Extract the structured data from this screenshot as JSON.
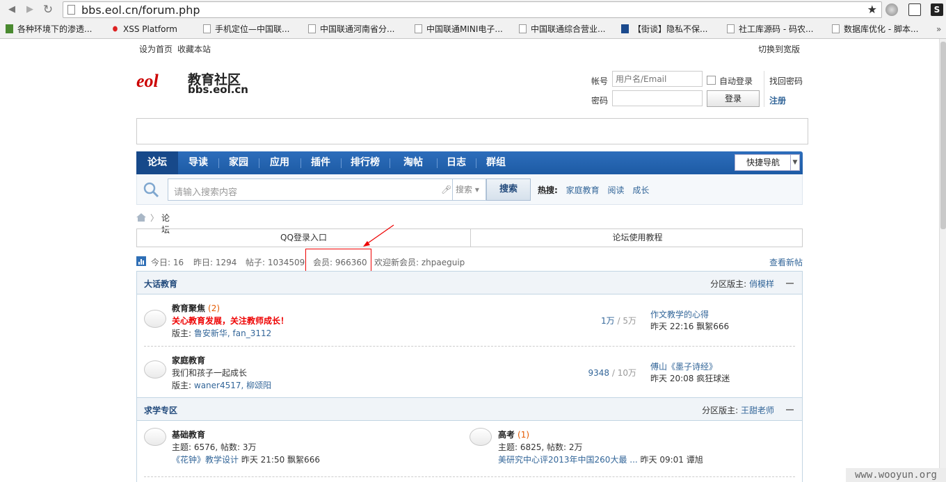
{
  "browser": {
    "url": "bbs.eol.cn/forum.php",
    "bookmarks": [
      "各种环境下的渗透...",
      "XSS Platform",
      "手机定位—中国联...",
      "中国联通河南省分...",
      "中国联通MINI电子...",
      "中国联通综合营业...",
      "【街谈】隐私不保...",
      "社工库源码 - 码农...",
      "数据库优化 - 脚本..."
    ]
  },
  "topbar": {
    "set_home": "设为首页",
    "favorite": "收藏本站",
    "switch_wide": "切换到宽版"
  },
  "logo": {
    "mark": "eol",
    "title": "教育社区",
    "domain": "bbs.eol.cn"
  },
  "login": {
    "account_label": "帐号",
    "account_placeholder": "用户名/Email",
    "password_label": "密码",
    "auto_login": "自动登录",
    "login_button": "登录",
    "find_password": "找回密码",
    "register": "注册"
  },
  "nav": {
    "items": [
      "论坛",
      "导读",
      "家园",
      "应用",
      "插件",
      "排行榜",
      "淘帖",
      "日志",
      "群组"
    ],
    "quick_nav": "快捷导航"
  },
  "search": {
    "placeholder": "请输入搜索内容",
    "scope": "搜索",
    "button": "搜索",
    "hot_label": "热搜:",
    "hot_terms": [
      "家庭教育",
      "阅读",
      "成长"
    ]
  },
  "breadcrumb": {
    "current": "论坛"
  },
  "shortcuts": {
    "qq": "QQ登录入口",
    "tutorial": "论坛使用教程"
  },
  "stats": {
    "today": "今日: 16",
    "yesterday": "昨日: 1294",
    "posts": "帖子: 1034509",
    "members": "会员: 966360",
    "welcome": "欢迎新会员: zhpaeguip",
    "new_posts": "查看新帖"
  },
  "categories": [
    {
      "name": "大话教育",
      "moderator_label": "分区版主:",
      "moderator": "俏模样",
      "forums": [
        {
          "name": "教育聚焦",
          "count": "(2)",
          "desc": "关心教育发展，关注教师成长！",
          "mod_label": "版主:",
          "mods": "鲁安新华, fan_3112",
          "threads": "1万",
          "posts": "5万",
          "last_title": "作文教学的心得",
          "last_info": "昨天 22:16 飘絮666"
        },
        {
          "name": "家庭教育",
          "count": "",
          "desc": "我们和孩子一起成长",
          "mod_label": "版主:",
          "mods": "waner4517, 柳颂阳",
          "threads": "9348",
          "posts": "10万",
          "last_title": "傅山《墨子诗经》",
          "last_info": "昨天 20:08 疯狂球迷"
        }
      ]
    },
    {
      "name": "求学专区",
      "moderator_label": "分区版主:",
      "moderator": "王甜老师",
      "forums": [
        {
          "name": "基础教育",
          "count": "",
          "stats": "主题: 6576, 帖数: 3万",
          "last_title": "《花钟》教学设计",
          "last_info": "昨天 21:50 飘絮666"
        },
        {
          "name": "高考",
          "count": "(1)",
          "stats": "主题: 6825, 帖数: 2万",
          "last_title": "美研究中心评2013年中国260大最 ...",
          "last_info": "昨天 09:01 谭旭"
        }
      ]
    }
  ],
  "watermark": "www.wooyun.org",
  "colors": {
    "nav_blue": "#2d6dbb",
    "highlight_red": "#e00000",
    "link": "#336699"
  }
}
